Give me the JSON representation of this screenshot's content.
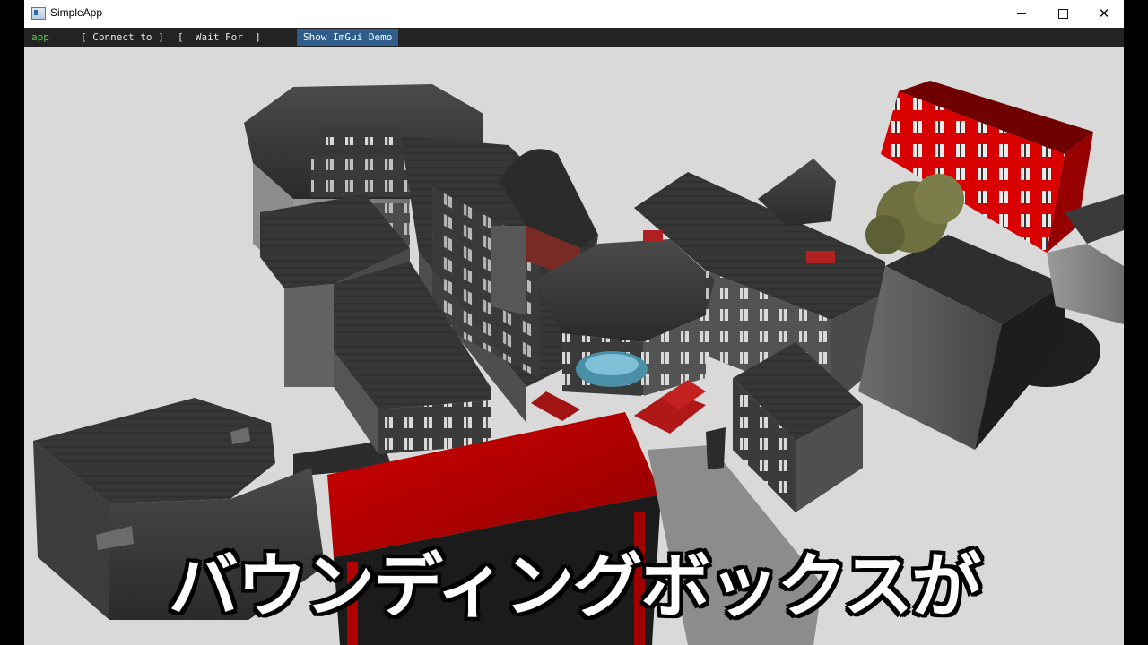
{
  "window": {
    "title": "SimpleApp",
    "icon": "app-window-icon",
    "controls": {
      "minimize_icon": "minimize-icon",
      "maximize_icon": "maximize-icon",
      "close_icon": "close-icon",
      "close_glyph": "✕"
    }
  },
  "menubar": {
    "app_label": "app",
    "connect_label": "[ Connect to ]",
    "wait_label": "[  Wait For  ]",
    "demo_label": "Show ImGui Demo",
    "colors": {
      "background": "#232323",
      "app_label": "#49d24d",
      "demo_button": "#2f5d8b"
    }
  },
  "viewport": {
    "background": "#d9d9d9",
    "scene": "3d-city-block-model",
    "accent_roof_color": "#c00000"
  },
  "subtitle": {
    "text": "バウンディングボックスが"
  }
}
